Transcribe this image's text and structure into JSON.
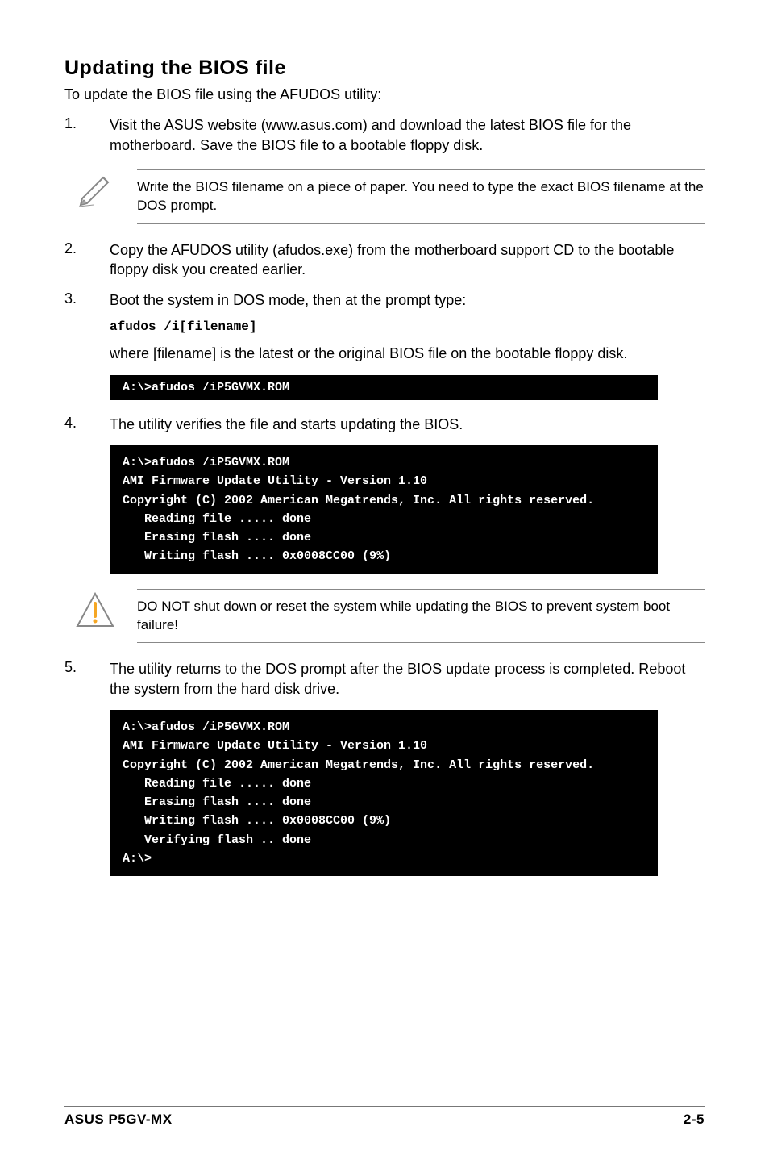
{
  "heading": "Updating the BIOS file",
  "intro": "To update the BIOS file using the AFUDOS utility:",
  "steps": {
    "s1": {
      "num": "1.",
      "text": "Visit the ASUS website (www.asus.com) and download the latest BIOS file for the motherboard. Save the BIOS file to a bootable floppy disk."
    },
    "note1": "Write the BIOS filename on a piece of paper. You need to type the exact BIOS filename at the DOS prompt.",
    "s2": {
      "num": "2.",
      "text": "Copy the AFUDOS utility (afudos.exe) from the motherboard support CD to the bootable floppy disk you created earlier."
    },
    "s3": {
      "num": "3.",
      "text1": "Boot the system in DOS mode, then at the prompt type:",
      "code": "afudos /i[filename]",
      "text2": "where [filename] is the latest or the original BIOS file on the bootable floppy disk."
    },
    "term1": "A:\\>afudos /iP5GVMX.ROM",
    "s4": {
      "num": "4.",
      "text": "The utility verifies the file and starts updating the BIOS."
    },
    "term2": "A:\\>afudos /iP5GVMX.ROM\nAMI Firmware Update Utility - Version 1.10\nCopyright (C) 2002 American Megatrends, Inc. All rights reserved.\n   Reading file ..... done\n   Erasing flash .... done\n   Writing flash .... 0x0008CC00 (9%)",
    "warn": "DO NOT shut down or reset the system while updating the BIOS to prevent system boot failure!",
    "s5": {
      "num": "5.",
      "text": "The utility returns to the DOS prompt after the BIOS update process is completed. Reboot the system from the hard disk drive."
    },
    "term3": "A:\\>afudos /iP5GVMX.ROM\nAMI Firmware Update Utility - Version 1.10\nCopyright (C) 2002 American Megatrends, Inc. All rights reserved.\n   Reading file ..... done\n   Erasing flash .... done\n   Writing flash .... 0x0008CC00 (9%)\n   Verifying flash .. done\nA:\\>"
  },
  "footer": {
    "left": "ASUS P5GV-MX",
    "right": "2-5"
  }
}
